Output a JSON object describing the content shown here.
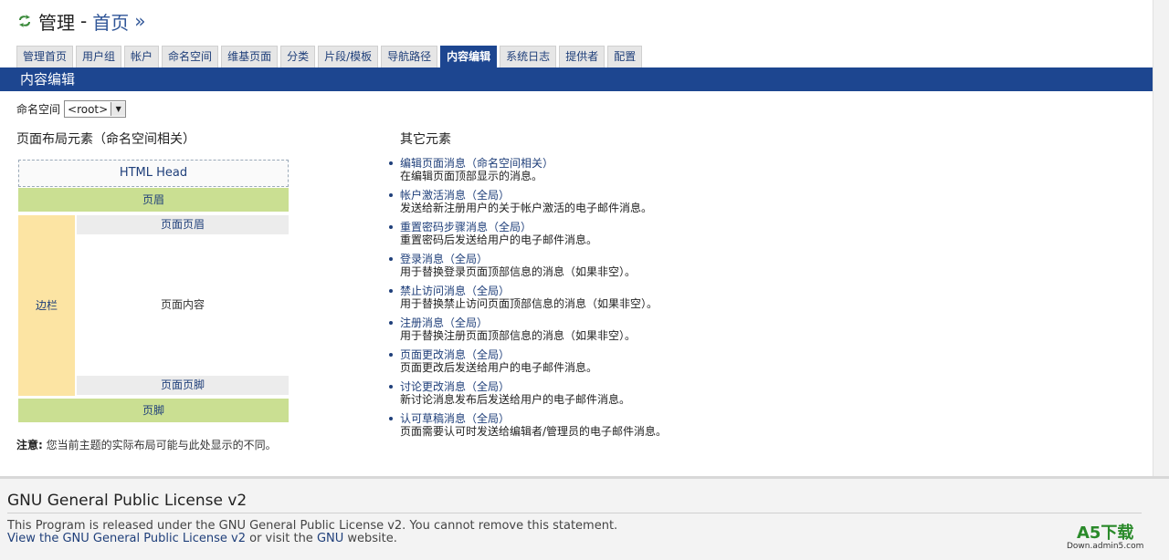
{
  "header": {
    "title": "管理",
    "separator": "-",
    "crumb": "首页",
    "raquo": "»"
  },
  "tabs": [
    {
      "label": "管理首页"
    },
    {
      "label": "用户组"
    },
    {
      "label": "帐户"
    },
    {
      "label": "命名空间"
    },
    {
      "label": "维基页面"
    },
    {
      "label": "分类"
    },
    {
      "label": "片段/模板"
    },
    {
      "label": "导航路径"
    },
    {
      "label": "内容编辑",
      "active": true
    },
    {
      "label": "系统日志"
    },
    {
      "label": "提供者"
    },
    {
      "label": "配置"
    }
  ],
  "section_bar": "内容编辑",
  "namespace": {
    "label": "命名空间",
    "selected": "<root>"
  },
  "layout_section": {
    "title": "页面布局元素（命名空间相关）",
    "html_head": "HTML Head",
    "header": "页眉",
    "sidebar": "边栏",
    "page_header": "页面页眉",
    "page_content": "页面内容",
    "page_footer": "页面页脚",
    "footer": "页脚"
  },
  "note": {
    "label": "注意:",
    "text": "您当前主题的实际布局可能与此处显示的不同。"
  },
  "others": {
    "title": "其它元素",
    "items": [
      {
        "link": "编辑页面消息（命名空间相关）",
        "desc": "在编辑页面顶部显示的消息。"
      },
      {
        "link": "帐户激活消息（全局）",
        "desc": "发送给新注册用户的关于帐户激活的电子邮件消息。"
      },
      {
        "link": "重置密码步骤消息（全局）",
        "desc": "重置密码后发送给用户的电子邮件消息。"
      },
      {
        "link": "登录消息（全局）",
        "desc": "用于替换登录页面顶部信息的消息（如果非空）。"
      },
      {
        "link": "禁止访问消息（全局）",
        "desc": "用于替换禁止访问页面顶部信息的消息（如果非空）。"
      },
      {
        "link": "注册消息（全局）",
        "desc": "用于替换注册页面顶部信息的消息（如果非空）。"
      },
      {
        "link": "页面更改消息（全局）",
        "desc": "页面更改后发送给用户的电子邮件消息。"
      },
      {
        "link": "讨论更改消息（全局）",
        "desc": "新讨论消息发布后发送给用户的电子邮件消息。"
      },
      {
        "link": "认可草稿消息（全局）",
        "desc": "页面需要认可时发送给编辑者/管理员的电子邮件消息。"
      }
    ]
  },
  "footer": {
    "title": "GNU General Public License v2",
    "line1": "This Program is released under the GNU General Public License v2. You cannot remove this statement.",
    "line2_link1": "View the GNU General Public License v2",
    "line2_mid": " or visit the ",
    "line2_link2": "GNU",
    "line2_end": " website."
  },
  "watermark": {
    "brand": "A5下载",
    "url": "Down.admin5.com"
  },
  "colors": {
    "accent": "#1d4690",
    "header_bg": "#cadf92",
    "sidebar_bg": "#fce4a3",
    "link": "#1f3f7a"
  }
}
